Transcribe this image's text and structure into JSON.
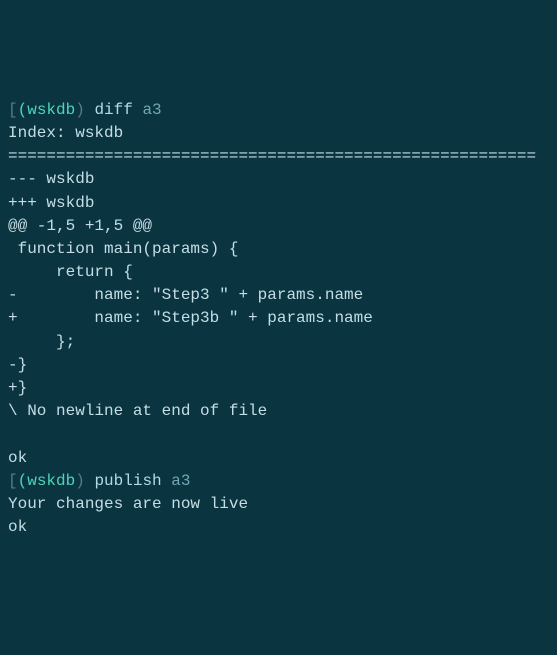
{
  "line1": {
    "bracket_open": "[",
    "bracket_close": ")",
    "prompt": "(wskdb",
    "command": "diff",
    "arg": "a3"
  },
  "diff": {
    "index": "Index: wskdb",
    "sep": "=======================================================",
    "minus_header": "--- wskdb",
    "plus_header": "+++ wskdb",
    "hunk": "@@ -1,5 +1,5 @@",
    "l1": " function main(params) {",
    "l2": "     return {",
    "l3": "-        name: \"Step3 \" + params.name",
    "l4": "+        name: \"Step3b \" + params.name",
    "l5": "     };",
    "l6": "-}",
    "l7": "+}",
    "no_newline": "\\ No newline at end of file"
  },
  "ok1": "ok",
  "line2": {
    "bracket_open": "[",
    "bracket_close": ")",
    "prompt": "(wskdb",
    "command": "publish",
    "arg": "a3"
  },
  "live_msg": "Your changes are now live",
  "ok2": "ok"
}
